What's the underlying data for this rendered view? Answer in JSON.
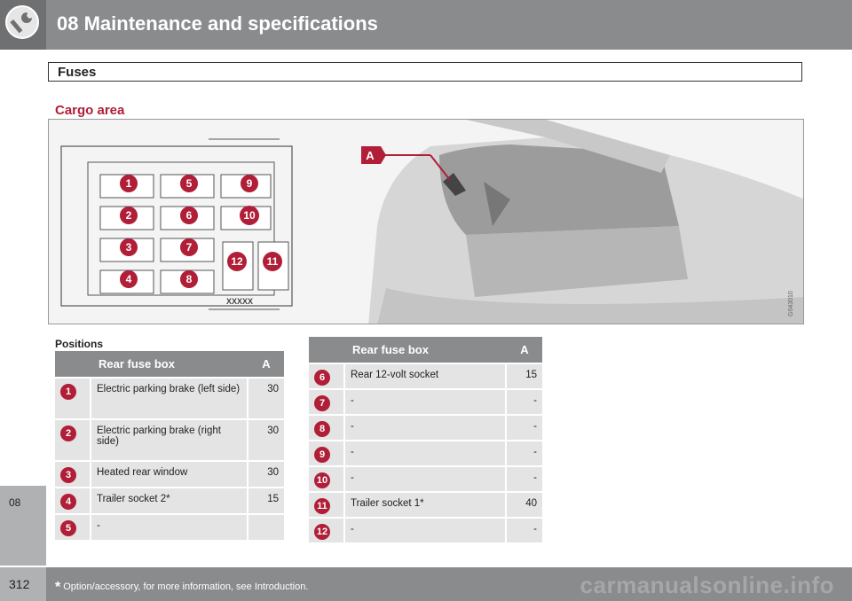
{
  "header": {
    "title": "08 Maintenance and specifications"
  },
  "section": {
    "title": "Fuses"
  },
  "subtitle": "Cargo area",
  "illustration": {
    "callout_a": "A",
    "box_code": "XXXXX",
    "figure_id": "G043010",
    "fuse_numbers": [
      "1",
      "2",
      "3",
      "4",
      "5",
      "6",
      "7",
      "8",
      "9",
      "10",
      "11",
      "12"
    ]
  },
  "positions_label": "Positions",
  "table_left": {
    "headers": {
      "name": "Rear fuse box",
      "amp": "A"
    },
    "rows": [
      {
        "num": "1",
        "name": "Electric parking brake (left side)",
        "amp": "30"
      },
      {
        "num": "2",
        "name": "Electric parking brake (right side)",
        "amp": "30"
      },
      {
        "num": "3",
        "name": "Heated rear window",
        "amp": "30"
      },
      {
        "num": "4",
        "name": "Trailer socket 2*",
        "amp": "15"
      },
      {
        "num": "5",
        "name": "-",
        "amp": ""
      }
    ]
  },
  "table_right": {
    "headers": {
      "name": "Rear fuse box",
      "amp": "A"
    },
    "rows": [
      {
        "num": "6",
        "name": "Rear 12-volt socket",
        "amp": "15"
      },
      {
        "num": "7",
        "name": "-",
        "amp": "-"
      },
      {
        "num": "8",
        "name": "-",
        "amp": "-"
      },
      {
        "num": "9",
        "name": "-",
        "amp": "-"
      },
      {
        "num": "10",
        "name": "-",
        "amp": "-"
      },
      {
        "num": "11",
        "name": "Trailer socket 1*",
        "amp": "40"
      },
      {
        "num": "12",
        "name": "-",
        "amp": "-"
      }
    ]
  },
  "side_tab": "08",
  "footer": {
    "page_number": "312",
    "asterisk": "*",
    "note": "Option/accessory, for more information, see Introduction.",
    "watermark": "carmanualsonline.info"
  },
  "colors": {
    "accent": "#b01e37",
    "header_gray": "#8a8b8d",
    "cell_gray": "#e4e4e5"
  }
}
